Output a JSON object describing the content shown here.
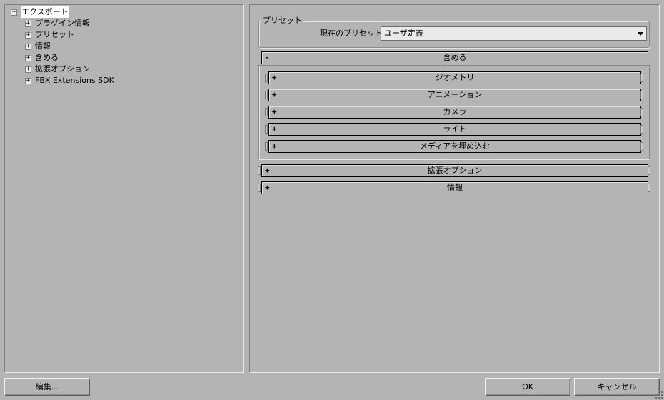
{
  "tree": {
    "root": {
      "toggle": "−",
      "label": "エクスポート"
    },
    "children": [
      {
        "toggle": "+",
        "label": "プラグイン情報"
      },
      {
        "toggle": "+",
        "label": "プリセット"
      },
      {
        "toggle": "+",
        "label": "情報"
      },
      {
        "toggle": "+",
        "label": "含める"
      },
      {
        "toggle": "+",
        "label": "拡張オプション"
      },
      {
        "toggle": "+",
        "label": "FBX Extensions SDK"
      }
    ]
  },
  "preset": {
    "group_title": "プリセット",
    "current_label": "現在のプリセット:",
    "current_value": "ユーザ定義"
  },
  "rollouts": {
    "include": {
      "sign": "-",
      "label": "含める",
      "children": [
        {
          "sign": "+",
          "label": "ジオメトリ"
        },
        {
          "sign": "+",
          "label": "アニメーション"
        },
        {
          "sign": "+",
          "label": "カメラ"
        },
        {
          "sign": "+",
          "label": "ライト"
        },
        {
          "sign": "+",
          "label": "メディアを埋め込む"
        }
      ]
    },
    "advanced": {
      "sign": "+",
      "label": "拡張オプション"
    },
    "info": {
      "sign": "+",
      "label": "情報"
    }
  },
  "buttons": {
    "edit": "編集...",
    "ok": "OK",
    "cancel": "キャンセル"
  }
}
